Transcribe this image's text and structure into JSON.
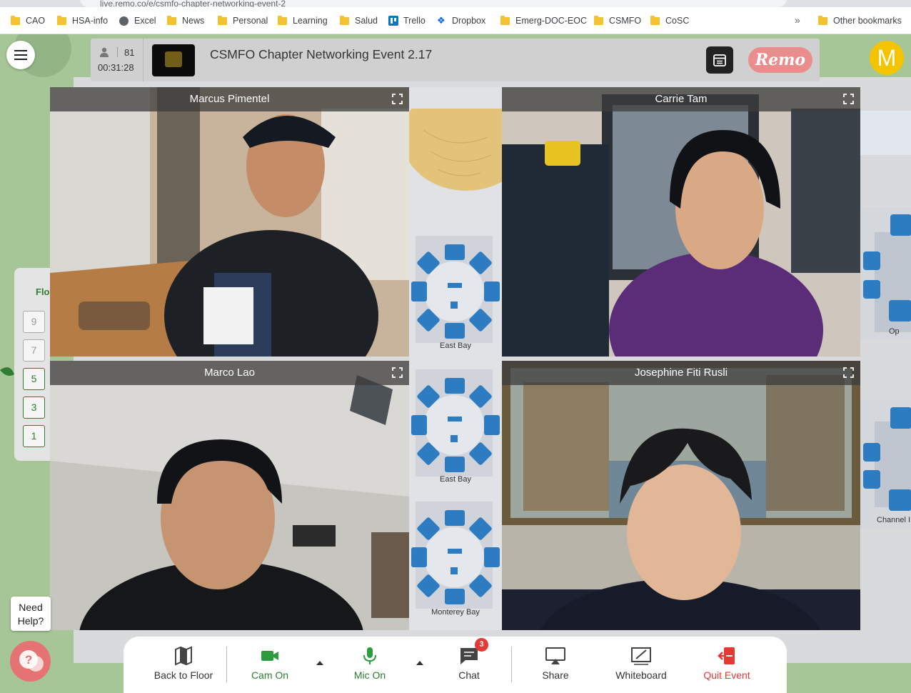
{
  "browser": {
    "address_text": "live.remo.co/e/csmfo-chapter-networking-event-2",
    "bookmarks": [
      "CAO",
      "HSA-info",
      "Excel",
      "News",
      "Personal",
      "Learning",
      "Salud",
      "Trello",
      "Dropbox",
      "Emerg-DOC-EOC",
      "CSMFO",
      "CoSC"
    ],
    "more": "»",
    "other_bookmarks": "Other bookmarks"
  },
  "event": {
    "attendees": "81",
    "timer": "00:31:28",
    "title": "CSMFO Chapter Networking Event 2.17",
    "brand": "Remo"
  },
  "user": {
    "avatar_initial": "M"
  },
  "floor_picker": {
    "label": "Flo",
    "floors": [
      "9",
      "7",
      "5",
      "3",
      "1"
    ]
  },
  "tiles": [
    {
      "name": "Marcus Pimentel"
    },
    {
      "name": "Carrie Tam"
    },
    {
      "name": "Marco Lao"
    },
    {
      "name": "Josephine Fiti Rusli"
    }
  ],
  "tables": [
    {
      "label": "East Bay"
    },
    {
      "label": "East Bay"
    },
    {
      "label": "Monterey Bay"
    }
  ],
  "right_rooms": {
    "label1": "Op",
    "label2": "Channel I"
  },
  "toolbar": {
    "back_to_floor": "Back to Floor",
    "cam": "Cam On",
    "mic": "Mic On",
    "chat": "Chat",
    "chat_badge": "3",
    "share": "Share",
    "whiteboard": "Whiteboard",
    "quit": "Quit Event"
  },
  "help": {
    "text": "Need Help?"
  },
  "colors": {
    "accent_green": "#2e7d32",
    "quit_red": "#e53935",
    "avatar_yellow": "#f5c400",
    "remo_pink": "#ec8d8d"
  }
}
